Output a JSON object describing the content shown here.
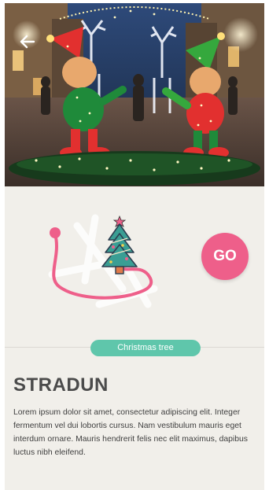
{
  "header": {
    "back_icon": "arrow-left-icon"
  },
  "route": {
    "go_label": "GO",
    "tree_icon": "christmas-tree-icon",
    "accent_color": "#ee5f8a"
  },
  "place": {
    "tag": "Christmas tree",
    "tag_color": "#5fc6ab",
    "title": "STRADUN",
    "description": "Lorem ipsum dolor sit amet, consectetur adipiscing elit. Integer fermentum vel dui lobortis cursus. Nam vestibulum mauris eget interdum ornare. Mauris hendrerit felis nec elit maximus, dapibus luctus nibh eleifend."
  }
}
